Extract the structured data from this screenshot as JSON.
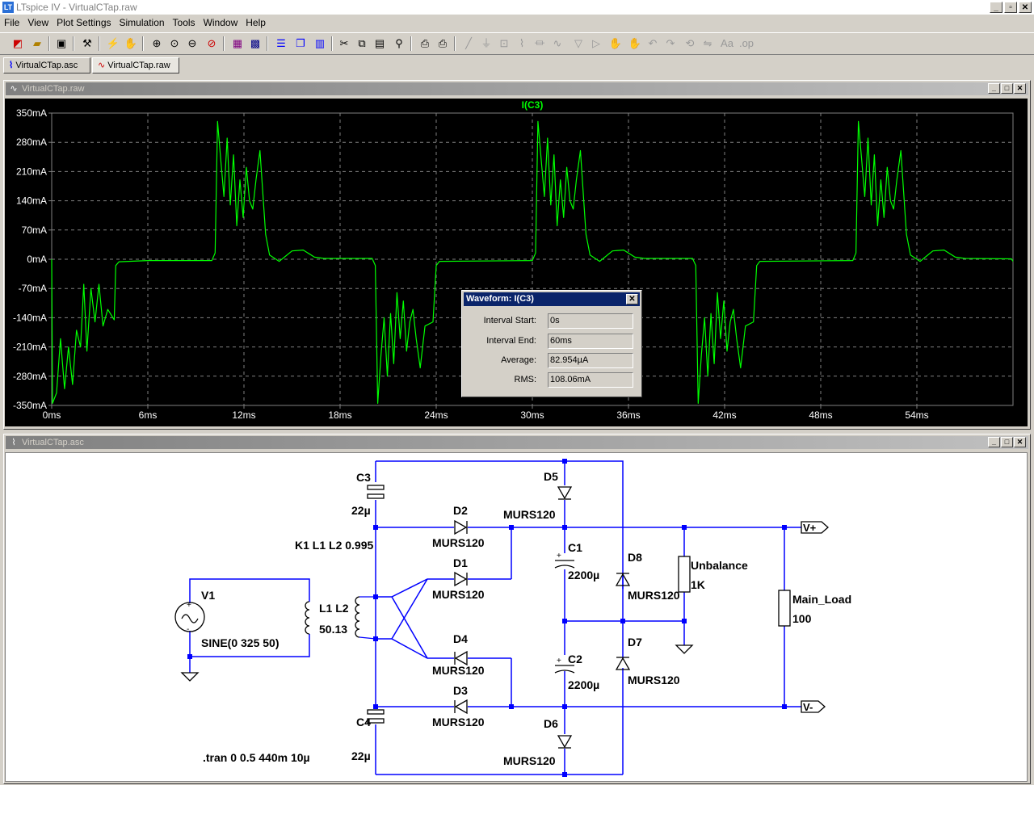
{
  "window": {
    "title": "LTspice IV - VirtualCTap.raw",
    "min": "_",
    "restore": "▫",
    "close": "✕"
  },
  "menu": [
    "File",
    "View",
    "Plot Settings",
    "Simulation",
    "Tools",
    "Window",
    "Help"
  ],
  "tabs": [
    {
      "label": "VirtualCTap.asc",
      "icon": "schematic-icon"
    },
    {
      "label": "VirtualCTap.raw",
      "icon": "waveform-icon"
    }
  ],
  "plot_window": {
    "title": "VirtualCTap.raw"
  },
  "schematic_window": {
    "title": "VirtualCTap.asc"
  },
  "colors": {
    "trace": "#00ff00",
    "grid": "#808080",
    "plot_bg": "#000000",
    "wire": "#0000ff",
    "node": "#0000ff",
    "label": "#ffffff"
  },
  "chart_data": {
    "type": "line",
    "title": "I(C3)",
    "xlabel": "",
    "ylabel": "",
    "xlim": [
      0,
      60
    ],
    "ylim": [
      -350,
      350
    ],
    "x_unit": "ms",
    "y_unit": "mA",
    "grid": true,
    "x_ticks": [
      "0ms",
      "6ms",
      "12ms",
      "18ms",
      "24ms",
      "30ms",
      "36ms",
      "42ms",
      "48ms",
      "54ms"
    ],
    "y_ticks": [
      "350mA",
      "280mA",
      "210mA",
      "140mA",
      "70mA",
      "0mA",
      "-70mA",
      "-140mA",
      "-210mA",
      "-280mA",
      "-350mA"
    ],
    "series": [
      {
        "name": "I(C3)",
        "points": [
          [
            0.0,
            0
          ],
          [
            0.05,
            -345
          ],
          [
            0.3,
            -320
          ],
          [
            0.55,
            -190
          ],
          [
            0.8,
            -310
          ],
          [
            1.05,
            -210
          ],
          [
            1.3,
            -300
          ],
          [
            1.55,
            -170
          ],
          [
            1.8,
            -210
          ],
          [
            2.0,
            -60
          ],
          [
            2.2,
            -220
          ],
          [
            2.45,
            -70
          ],
          [
            2.7,
            -150
          ],
          [
            2.95,
            -60
          ],
          [
            3.2,
            -160
          ],
          [
            3.5,
            -120
          ],
          [
            3.9,
            -145
          ],
          [
            4.0,
            -15
          ],
          [
            4.2,
            -6
          ],
          [
            6,
            -3
          ],
          [
            8,
            -3
          ],
          [
            10,
            -3
          ],
          [
            10.2,
            15
          ],
          [
            10.35,
            330
          ],
          [
            10.55,
            240
          ],
          [
            10.75,
            150
          ],
          [
            10.95,
            290
          ],
          [
            11.15,
            130
          ],
          [
            11.35,
            250
          ],
          [
            11.55,
            80
          ],
          [
            11.75,
            190
          ],
          [
            11.95,
            100
          ],
          [
            12.15,
            220
          ],
          [
            12.35,
            140
          ],
          [
            12.55,
            120
          ],
          [
            12.75,
            190
          ],
          [
            13.0,
            260
          ],
          [
            13.35,
            60
          ],
          [
            13.6,
            10
          ],
          [
            14.2,
            -5
          ],
          [
            15.0,
            20
          ],
          [
            15.7,
            22
          ],
          [
            16.4,
            5
          ],
          [
            17.0,
            2
          ],
          [
            20.0,
            2
          ],
          [
            20.2,
            -15
          ],
          [
            20.35,
            -345
          ],
          [
            20.55,
            -230
          ],
          [
            20.75,
            -140
          ],
          [
            20.95,
            -280
          ],
          [
            21.15,
            -130
          ],
          [
            21.35,
            -250
          ],
          [
            21.55,
            -80
          ],
          [
            21.75,
            -190
          ],
          [
            21.95,
            -100
          ],
          [
            22.15,
            -220
          ],
          [
            22.35,
            -150
          ],
          [
            22.55,
            -120
          ],
          [
            22.75,
            -190
          ],
          [
            23.0,
            -260
          ],
          [
            23.3,
            -160
          ],
          [
            23.8,
            -150
          ],
          [
            24.0,
            -15
          ],
          [
            24.2,
            -5
          ],
          [
            30.0,
            -3
          ],
          [
            30.2,
            15
          ],
          [
            30.35,
            330
          ],
          [
            30.55,
            240
          ],
          [
            30.75,
            150
          ],
          [
            30.95,
            290
          ],
          [
            31.15,
            130
          ],
          [
            31.35,
            250
          ],
          [
            31.55,
            80
          ],
          [
            31.75,
            190
          ],
          [
            31.95,
            100
          ],
          [
            32.15,
            220
          ],
          [
            32.35,
            140
          ],
          [
            32.55,
            120
          ],
          [
            32.75,
            190
          ],
          [
            33.0,
            260
          ],
          [
            33.35,
            60
          ],
          [
            33.6,
            10
          ],
          [
            34.2,
            -5
          ],
          [
            35.0,
            20
          ],
          [
            35.7,
            22
          ],
          [
            36.4,
            5
          ],
          [
            37.0,
            2
          ],
          [
            40.0,
            2
          ],
          [
            40.2,
            -15
          ],
          [
            40.35,
            -345
          ],
          [
            40.55,
            -230
          ],
          [
            40.75,
            -140
          ],
          [
            40.95,
            -280
          ],
          [
            41.15,
            -130
          ],
          [
            41.35,
            -250
          ],
          [
            41.55,
            -80
          ],
          [
            41.75,
            -190
          ],
          [
            41.95,
            -100
          ],
          [
            42.15,
            -220
          ],
          [
            42.35,
            -150
          ],
          [
            42.55,
            -120
          ],
          [
            42.75,
            -190
          ],
          [
            43.0,
            -260
          ],
          [
            43.3,
            -160
          ],
          [
            43.8,
            -150
          ],
          [
            44.0,
            -15
          ],
          [
            44.2,
            -5
          ],
          [
            50.0,
            -3
          ],
          [
            50.2,
            15
          ],
          [
            50.35,
            330
          ],
          [
            50.55,
            240
          ],
          [
            50.75,
            150
          ],
          [
            50.95,
            290
          ],
          [
            51.15,
            130
          ],
          [
            51.35,
            250
          ],
          [
            51.55,
            80
          ],
          [
            51.75,
            190
          ],
          [
            51.95,
            100
          ],
          [
            52.15,
            220
          ],
          [
            52.35,
            140
          ],
          [
            52.55,
            120
          ],
          [
            52.75,
            190
          ],
          [
            53.0,
            260
          ],
          [
            53.35,
            60
          ],
          [
            53.6,
            10
          ],
          [
            54.2,
            -5
          ],
          [
            55.0,
            20
          ],
          [
            55.7,
            22
          ],
          [
            56.4,
            5
          ],
          [
            57.0,
            2
          ],
          [
            59.9,
            1
          ],
          [
            60,
            -5
          ]
        ]
      }
    ]
  },
  "dialog": {
    "title": "Waveform: I(C3)",
    "close": "✕",
    "rows": [
      {
        "label": "Interval Start:",
        "value": "0s"
      },
      {
        "label": "Interval End:",
        "value": "60ms"
      },
      {
        "label": "Average:",
        "value": "82.954µA"
      },
      {
        "label": "RMS:",
        "value": "108.06mA"
      }
    ]
  },
  "schematic": {
    "c3": {
      "name": "C3",
      "value": "22µ"
    },
    "c4": {
      "name": "C4",
      "value": "22µ"
    },
    "c1": {
      "name": "C1",
      "value": "2200µ"
    },
    "c2": {
      "name": "C2",
      "value": "2200µ"
    },
    "d1": {
      "name": "D1",
      "model": "MURS120"
    },
    "d2": {
      "name": "D2",
      "model": "MURS120"
    },
    "d3": {
      "name": "D3",
      "model": "MURS120"
    },
    "d4": {
      "name": "D4",
      "model": "MURS120"
    },
    "d5": {
      "name": "D5",
      "model": "MURS120"
    },
    "d6": {
      "name": "D6",
      "model": "MURS120"
    },
    "d7": {
      "name": "D7",
      "model": "MURS120"
    },
    "d8": {
      "name": "D8",
      "model": "MURS120"
    },
    "v1": {
      "name": "V1",
      "value": "SINE(0 325 50)"
    },
    "k1": "K1 L1 L2 0.995",
    "l": {
      "name": "L1 L2",
      "value": "50.13"
    },
    "unbalance": {
      "name": "Unbalance",
      "value": "1K"
    },
    "main_load": {
      "name": "Main_Load",
      "value": "100"
    },
    "vplus": "V+",
    "vminus": "V-",
    "tran": ".tran 0 0.5 440m 10µ"
  }
}
